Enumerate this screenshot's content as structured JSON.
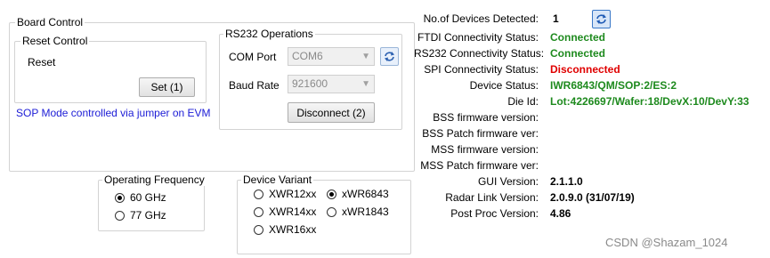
{
  "board_control": {
    "title": "Board Control",
    "reset_control": {
      "title": "Reset Control",
      "label": "Reset",
      "set_button": "Set (1)"
    },
    "sop_note": "SOP Mode controlled via jumper on EVM",
    "rs232": {
      "title": "RS232 Operations",
      "com_port_label": "COM Port",
      "com_port_value": "COM6",
      "baud_rate_label": "Baud Rate",
      "baud_rate_value": "921600",
      "disconnect_button": "Disconnect (2)"
    }
  },
  "operating_frequency": {
    "title": "Operating Frequency",
    "options": [
      {
        "label": "60 GHz",
        "selected": true
      },
      {
        "label": "77 GHz",
        "selected": false
      }
    ]
  },
  "device_variant": {
    "title": "Device Variant",
    "options": [
      {
        "label": "XWR12xx",
        "selected": false
      },
      {
        "label": "xWR6843",
        "selected": true
      },
      {
        "label": "XWR14xx",
        "selected": false
      },
      {
        "label": "xWR1843",
        "selected": false
      },
      {
        "label": "XWR16xx",
        "selected": false
      }
    ]
  },
  "status": {
    "devices_detected_label": "No.of Devices Detected:",
    "devices_detected_value": "1",
    "rows": [
      {
        "label": "FTDI Connectivity Status:",
        "value": "Connected",
        "color": "#1e8a1e"
      },
      {
        "label": "RS232 Connectivity Status:",
        "value": "Connected",
        "color": "#1e8a1e"
      },
      {
        "label": "SPI Connectivity Status:",
        "value": "Disconnected",
        "color": "#e00000"
      },
      {
        "label": "Device Status:",
        "value": "IWR6843/QM/SOP:2/ES:2",
        "color": "#1e8a1e"
      },
      {
        "label": "Die Id:",
        "value": "Lot:4226697/Wafer:18/DevX:10/DevY:33",
        "color": "#1e8a1e"
      },
      {
        "label": "BSS firmware version:",
        "value": "",
        "color": "#000000"
      },
      {
        "label": "BSS Patch firmware ver:",
        "value": "",
        "color": "#000000"
      },
      {
        "label": "MSS firmware version:",
        "value": "",
        "color": "#000000"
      },
      {
        "label": "MSS Patch firmware ver:",
        "value": "",
        "color": "#000000"
      },
      {
        "label": "GUI Version:",
        "value": "2.1.1.0",
        "color": "#000000"
      },
      {
        "label": "Radar Link Version:",
        "value": "2.0.9.0 (31/07/19)",
        "color": "#000000"
      },
      {
        "label": "Post Proc Version:",
        "value": "4.86",
        "color": "#000000"
      }
    ]
  },
  "watermark": "CSDN @Shazam_1024",
  "icons": {
    "refresh": "refresh-icon",
    "dropdown": "chevron-down-icon"
  }
}
